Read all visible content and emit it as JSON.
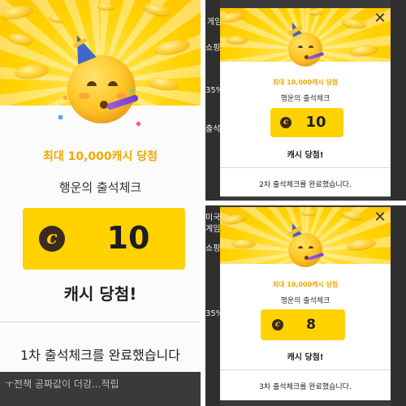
{
  "main": {
    "prize_title": "최대 10,000캐시 당첨",
    "subtitle": "행운의 출석체크",
    "cash_symbol": "c",
    "cash_amount": "10",
    "won_label": "캐시 당첨!",
    "completion": "1차 출석체크를 완료했습니다",
    "bottom_fragment": "ㅜ전책  공짜값이 더강...적립"
  },
  "top_right": {
    "prize_title": "최대 10,000캐시 당첨",
    "subtitle": "행운의 출석체크",
    "cash_symbol": "c",
    "cash_amount": "10",
    "won_label": "캐시 당첨!",
    "completion": "2차 출석체크를 완료했습니다.",
    "close_symbol": "✕",
    "bg_texts": [
      "게임",
      "쇼핑",
      "35%",
      "출석"
    ]
  },
  "bottom_right": {
    "prize_title": "최대 10,000캐시 당첨",
    "subtitle": "행운의 출석체크",
    "cash_symbol": "c",
    "cash_amount": "8",
    "won_label": "캐시 당첨!",
    "completion": "3차 출석체크를 완료했습니다.",
    "close_symbol": "✕",
    "bg_texts": [
      "미국",
      "계임",
      "쇼핑",
      "35%"
    ]
  },
  "colors": {
    "accent_yellow": "#ffd200",
    "gold_text": "#f0a800",
    "cash_icon_bg": "#3b2a20"
  },
  "icons": {
    "emoji": "partying-face-emoji-icon",
    "cash": "cash-coin-icon",
    "close": "close-icon"
  }
}
